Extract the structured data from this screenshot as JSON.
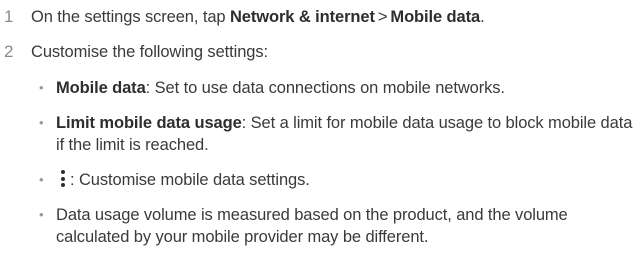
{
  "steps": [
    {
      "number": "1",
      "text_before": "On the settings screen, tap ",
      "bold_1": "Network & internet",
      "separator": ">",
      "bold_2": "Mobile data",
      "text_after": "."
    },
    {
      "number": "2",
      "text": "Customise the following settings:"
    }
  ],
  "bullets": [
    {
      "marker": "•",
      "term": "Mobile data",
      "description": ": Set to use data connections on mobile networks."
    },
    {
      "marker": "•",
      "term": "Limit mobile data usage",
      "description": ": Set a limit for mobile data usage to block mobile data if the limit is reached."
    },
    {
      "marker": "•",
      "icon": "more-options-icon",
      "description": ": Customise mobile data settings."
    },
    {
      "marker": "•",
      "description": "Data usage volume is measured based on the product, and the volume calculated by your mobile provider may be different."
    }
  ]
}
